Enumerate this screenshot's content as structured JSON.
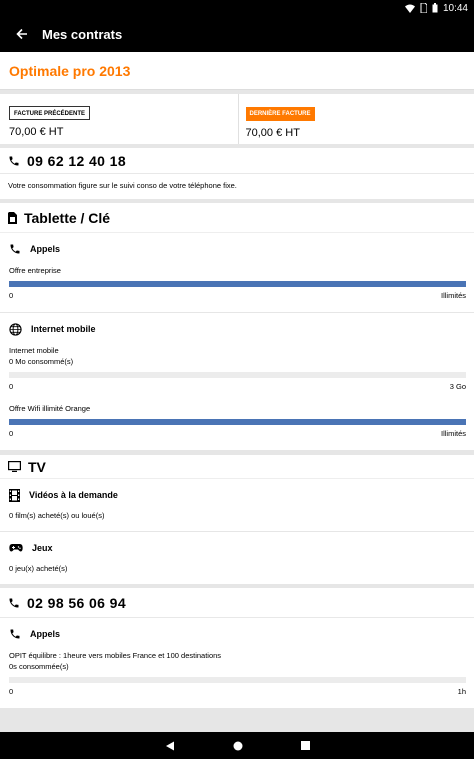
{
  "status_bar": {
    "time": "10:44"
  },
  "app_bar": {
    "title": "Mes contrats"
  },
  "plan": {
    "name": "Optimale pro 2013"
  },
  "invoices": {
    "previous": {
      "tag": "FACTURE PRÉCÉDENTE",
      "amount": "70,00 € HT"
    },
    "last": {
      "tag": "DERNIÈRE FACTURE",
      "amount": "70,00 € HT"
    }
  },
  "fixed_line": {
    "number": "09 62 12 40 18",
    "note": "Votre consommation figure sur le suivi conso de votre téléphone fixe."
  },
  "tablet": {
    "title": "Tablette / Clé",
    "calls": {
      "name": "Appels",
      "label": "Offre entreprise",
      "min": "0",
      "max": "Illimités",
      "fill": 1.0
    },
    "internet": {
      "name": "Internet mobile",
      "label1": "Internet mobile",
      "label2": "0 Mo consommé(s)",
      "min": "0",
      "max": "3 Go",
      "fill": 0.0,
      "wifi": {
        "label": "Offre Wifi illimité Orange",
        "min": "0",
        "max": "Illimités",
        "fill": 1.0
      }
    }
  },
  "tv": {
    "title": "TV",
    "vod": {
      "name": "Vidéos à la demande",
      "text": "0 film(s) acheté(s) ou loué(s)"
    },
    "games": {
      "name": "Jeux",
      "text": "0 jeu(x) acheté(s)"
    }
  },
  "mobile_line": {
    "number": "02 98 56 06 94",
    "calls": {
      "name": "Appels",
      "label1": "OPIT équilibre : 1heure vers mobiles France et 100 destinations",
      "label2": "0s consommée(s)",
      "min": "0",
      "max": "1h",
      "fill": 0.0
    }
  },
  "colors": {
    "accent": "#ff7900",
    "bar": "#4a74b5"
  }
}
